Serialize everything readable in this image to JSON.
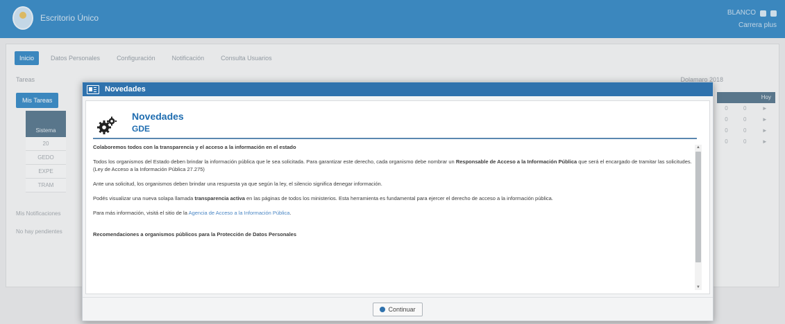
{
  "app": {
    "title": "Escritorio Único",
    "user_label": "BLANCO",
    "user_sub": "Carrera plus"
  },
  "tabs": [
    "Inicio",
    "Datos Personales",
    "Configuración",
    "Notificación",
    "Consulta Usuarios"
  ],
  "background": {
    "sub_left": "Tareas",
    "sub_right": "Dolamaro 2018",
    "mis_button": "Mis Tareas",
    "left_col_header": "Sistema",
    "left_col_cells": [
      "20",
      "GEDO",
      "EXPE",
      "TRAM"
    ],
    "note1": "Mis Notificaciones",
    "note2": "No hay pendientes",
    "right_table_header": "Hoy",
    "right_rows": [
      [
        "0",
        "0",
        "►"
      ],
      [
        "0",
        "0",
        "►"
      ],
      [
        "0",
        "0",
        "►"
      ],
      [
        "0",
        "0",
        "►"
      ]
    ]
  },
  "modal": {
    "header_title": "Novedades",
    "heading": "Novedades",
    "subheading": "GDE",
    "para1": "Colaboremos todos con la transparencia y el acceso a la información en el estado",
    "para2a": "Todos los organismos del Estado deben brindar la información pública que le sea solicitada. Para garantizar este derecho, cada organismo debe nombrar un ",
    "para2b": "Responsable de Acceso a la Información Pública",
    "para2c": " que será el encargado de tramitar las solicitudes.",
    "para2d": "(Ley de Acceso a la Información Pública 27.275)",
    "para3": "Ante una solicitud, los organismos deben brindar una respuesta ya que según la ley, el silencio significa denegar información.",
    "para4a": "Podés visualizar una nueva solapa llamada ",
    "para4b": "transparencia activa",
    "para4c": " en las páginas de todos los ministerios.  Esta herramienta es fundamental para ejercer el derecho de acceso a la información pública.",
    "para5a": "Para más información, visitá el sitio de la ",
    "para5b": "Agencia de Acceso a la Información Pública",
    "para5c": ".",
    "para6": "Recomendaciones a organismos públicos para la Protección de Datos Personales",
    "continue_label": "Continuar"
  },
  "colors": {
    "topbar": "#3f8fc9",
    "modal_header": "#2f72ad",
    "heading": "#1f6db0"
  }
}
